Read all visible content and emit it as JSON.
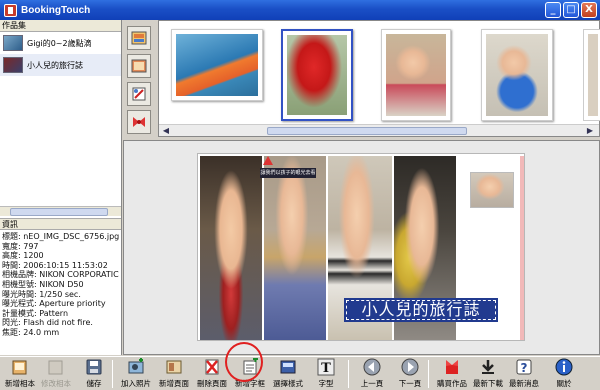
{
  "window": {
    "title": "BookingTouch",
    "controls": [
      "_",
      "□",
      "X"
    ]
  },
  "left_panel": {
    "albums_header": "作品集",
    "albums": [
      {
        "label": "Gigi的0~2歲點滴",
        "icon": "album-photo-icon"
      },
      {
        "label": "小人兒的旅行誌",
        "icon": "album-book-icon",
        "selected": true
      }
    ],
    "info_header": "資訊",
    "info_lines": [
      "標題: nEO_IMG_DSC_6756.jpg",
      "寬度: 797",
      "高度: 1200",
      "時間: 2006:10:15 11:53:02",
      "相機品牌: NIKON CORPORATIC",
      "相機型號: NIKON D50",
      "曝光時間: 1/250 sec.",
      "曝光程式: Aperture priority",
      "計量模式: Pattern",
      "閃光: Flash did not fire.",
      "焦距: 24.0 mm"
    ]
  },
  "side_tools": [
    "background-icon",
    "frame-icon",
    "clip-icon",
    "bow-icon"
  ],
  "strip": {
    "selected_index": 1
  },
  "page": {
    "title_text": "小人兒的旅行誌",
    "small_label": "讓我們以孩子的眼光去看"
  },
  "toolbar": {
    "items": [
      {
        "label": "新增相本",
        "icon": "new-album-icon",
        "dim": false
      },
      {
        "label": "修改相本",
        "icon": "edit-album-icon",
        "dim": true
      },
      {
        "label": "儲存",
        "icon": "save-icon",
        "dim": false
      },
      {
        "label": "加入照片",
        "icon": "add-photo-icon",
        "dim": false
      },
      {
        "label": "新增頁面",
        "icon": "add-page-icon",
        "dim": false
      },
      {
        "label": "刪除頁面",
        "icon": "delete-page-icon",
        "dim": false
      },
      {
        "label": "新增字框",
        "icon": "add-textbox-icon",
        "dim": false
      },
      {
        "label": "選擇樣式",
        "icon": "choose-style-icon",
        "dim": false
      },
      {
        "label": "字型",
        "icon": "font-icon",
        "dim": false
      },
      {
        "label": "上一頁",
        "icon": "prev-page-icon",
        "dim": false
      },
      {
        "label": "下一頁",
        "icon": "next-page-icon",
        "dim": false
      },
      {
        "label": "購買作品",
        "icon": "buy-icon",
        "dim": false
      },
      {
        "label": "最新下載",
        "icon": "download-icon",
        "dim": false
      },
      {
        "label": "最新消息",
        "icon": "news-icon",
        "dim": false
      },
      {
        "label": "關於",
        "icon": "about-icon",
        "dim": false
      }
    ]
  },
  "colors": {
    "titlebar": "#1a4fc6",
    "selection": "#3252c4",
    "title_box": "#213a8f",
    "highlight_circle": "#e02020"
  }
}
